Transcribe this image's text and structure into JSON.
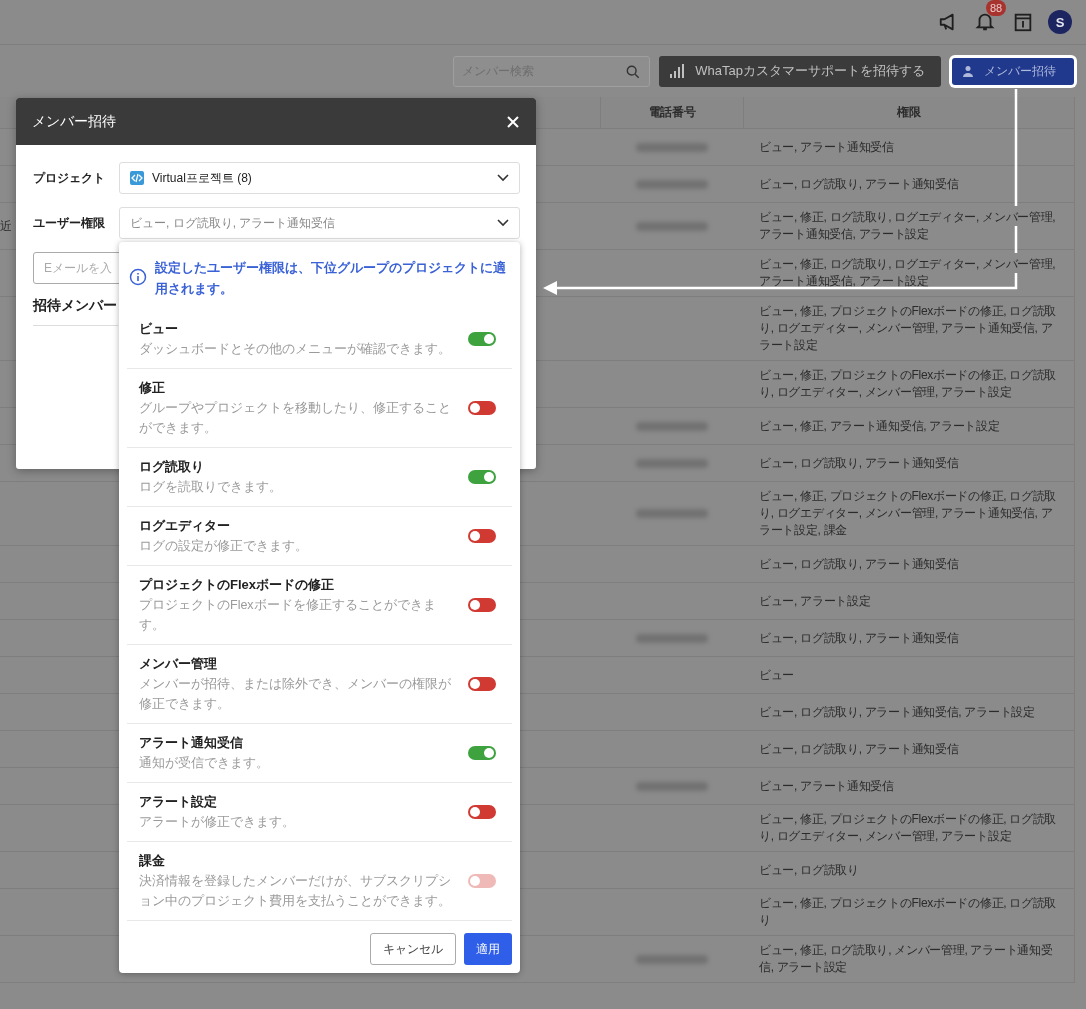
{
  "top_bar": {
    "notification_count": "88",
    "avatar_initial": "S"
  },
  "toolbar": {
    "search": {
      "placeholder": "メンバー検索"
    },
    "support_button": "WhaTapカスタマーサポートを招待する",
    "invite_button": "メンバー招待"
  },
  "table": {
    "columns": [
      "電話番号",
      "権限"
    ],
    "rows": [
      {
        "phone_redacted": true,
        "permissions": "ビュー, アラート通知受信"
      },
      {
        "phone_redacted": true,
        "permissions": "ビュー, ログ読取り, アラート通知受信"
      },
      {
        "column_1": "近",
        "phone_redacted": true,
        "permissions": "ビュー, 修正, ログ読取り, ログエディター, メンバー管理, アラート通知受信, アラート設定"
      },
      {
        "phone_redacted": false,
        "permissions": "ビュー, 修正, ログ読取り, ログエディター, メンバー管理, アラート通知受信, アラート設定"
      },
      {
        "phone_redacted": false,
        "permissions": "ビュー, 修正, プロジェクトのFlexボードの修正, ログ読取り, ログエディター, メンバー管理, アラート通知受信, アラート設定"
      },
      {
        "phone_redacted": false,
        "permissions": "ビュー, 修正, プロジェクトのFlexボードの修正, ログ読取り, ログエディター, メンバー管理, アラート設定"
      },
      {
        "phone_redacted": true,
        "permissions": "ビュー, 修正, アラート通知受信, アラート設定"
      },
      {
        "phone_redacted": true,
        "permissions": "ビュー, ログ読取り, アラート通知受信"
      },
      {
        "phone_redacted": true,
        "permissions": "ビュー, 修正, プロジェクトのFlexボードの修正, ログ読取り, ログエディター, メンバー管理, アラート通知受信, アラート設定, 課金"
      },
      {
        "phone_redacted": false,
        "permissions": "ビュー, ログ読取り, アラート通知受信"
      },
      {
        "phone_redacted": false,
        "permissions": "ビュー, アラート設定"
      },
      {
        "phone_redacted": true,
        "permissions": "ビュー, ログ読取り, アラート通知受信"
      },
      {
        "phone_redacted": false,
        "permissions": "ビュー"
      },
      {
        "phone_redacted": false,
        "permissions": "ビュー, ログ読取り, アラート通知受信, アラート設定"
      },
      {
        "phone_redacted": false,
        "permissions": "ビュー, ログ読取り, アラート通知受信"
      },
      {
        "phone_redacted": true,
        "permissions": "ビュー, アラート通知受信"
      },
      {
        "phone_redacted": false,
        "permissions": "ビュー, 修正, プロジェクトのFlexボードの修正, ログ読取り, ログエディター, メンバー管理, アラート設定"
      },
      {
        "phone_redacted": false,
        "permissions": "ビュー, ログ読取り"
      },
      {
        "phone_redacted": false,
        "permissions": "ビュー, 修正, プロジェクトのFlexボードの修正, ログ読取り"
      },
      {
        "phone_redacted": true,
        "permissions": "ビュー, 修正, ログ読取り, メンバー管理, アラート通知受信, アラート設定"
      }
    ]
  },
  "dialog": {
    "title": "メンバー招待",
    "project": {
      "label": "プロジェクト",
      "value": "Virtual프로젝트 (8)"
    },
    "user_permission": {
      "label": "ユーザー権限",
      "value": "ビュー, ログ読取り, アラート通知受信"
    },
    "email": {
      "placeholder": "Eメールを入"
    },
    "invited_members_heading": "招待メンバー"
  },
  "permission_menu": {
    "notice": "設定したユーザー権限は、下位グループのプロジェクトに適用されます。",
    "items": [
      {
        "title": "ビュー",
        "description": "ダッシュボードとその他のメニューが確認できます。",
        "checked": true,
        "disabled": false
      },
      {
        "title": "修正",
        "description": "グループやプロジェクトを移動したり、修正することができます。",
        "checked": false,
        "disabled": false
      },
      {
        "title": "ログ読取り",
        "description": "ログを読取りできます。",
        "checked": true,
        "disabled": false
      },
      {
        "title": "ログエディター",
        "description": "ログの設定が修正できます。",
        "checked": false,
        "disabled": false
      },
      {
        "title": "プロジェクトのFlexボードの修正",
        "description": "プロジェクトのFlexボードを修正することができます。",
        "checked": false,
        "disabled": false
      },
      {
        "title": "メンバー管理",
        "description": "メンバーが招待、または除外でき、メンバーの権限が修正できます。",
        "checked": false,
        "disabled": false
      },
      {
        "title": "アラート通知受信",
        "description": "通知が受信できます。",
        "checked": true,
        "disabled": false
      },
      {
        "title": "アラート設定",
        "description": "アラートが修正できます。",
        "checked": false,
        "disabled": false
      },
      {
        "title": "課金",
        "description": "決済情報を登録したメンバーだけが、サブスクリプション中のプロジェクト費用を支払うことができます。",
        "checked": false,
        "disabled": true
      }
    ],
    "cancel_button": "キャンセル",
    "apply_button": "適用"
  }
}
